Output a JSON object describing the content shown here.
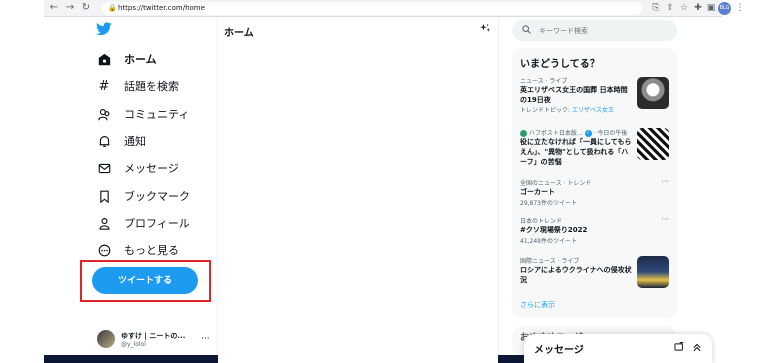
{
  "browser": {
    "url": "https://twitter.com/home",
    "profile_badge": "BLG"
  },
  "sidebar": {
    "items": [
      {
        "label": "ホーム",
        "icon": "home-icon",
        "glyph": "⌂"
      },
      {
        "label": "話題を検索",
        "icon": "hashtag-icon",
        "glyph": "#"
      },
      {
        "label": "コミュニティ",
        "icon": "community-icon",
        "glyph": "☺"
      },
      {
        "label": "通知",
        "icon": "bell-icon",
        "glyph": "🔔"
      },
      {
        "label": "メッセージ",
        "icon": "envelope-icon",
        "glyph": "✉"
      },
      {
        "label": "ブックマーク",
        "icon": "bookmark-icon",
        "glyph": "⌑"
      },
      {
        "label": "プロフィール",
        "icon": "person-icon",
        "glyph": "♙"
      },
      {
        "label": "もっと見る",
        "icon": "more-circle-icon",
        "glyph": "⋯"
      }
    ],
    "tweet_button": "ツイートする",
    "account": {
      "name": "ゆすけ | ニートの...",
      "handle": "@y_lolol",
      "more": "···"
    }
  },
  "main": {
    "title": "ホーム"
  },
  "right": {
    "search_placeholder": "キーワード検索",
    "trends_title": "いまどうしてる？",
    "trends": [
      {
        "meta": "ニュース · ライブ",
        "title": "英エリザベス女王の国葬 日本時間の19日夜",
        "sub_prefix": "トレンドトピック: ",
        "sub_link": "エリザベス女王"
      },
      {
        "meta_author": "ハフポスト日本版...",
        "meta_time": "· 今日の午後",
        "title": "役に立たなければ「一員にしてもらえん」、\"異物\"として扱われる「ハーフ」の苦悩"
      },
      {
        "meta": "全国のニュース · トレンド",
        "title": "ゴーカート",
        "count": "29,873件のツイート"
      },
      {
        "meta": "日本のトレンド",
        "title": "#クソ現場祭り2022",
        "count": "41,249件のツイート"
      },
      {
        "meta": "国際ニュース · ライブ",
        "title": "ロシアによるウクライナへの侵攻状況"
      }
    ],
    "show_more": "さらに表示",
    "second_card_title": "おすすめユーザー",
    "messages_title": "メッセージ"
  },
  "colors": {
    "accent": "#1d9bf0",
    "highlight": "#e0242b"
  }
}
